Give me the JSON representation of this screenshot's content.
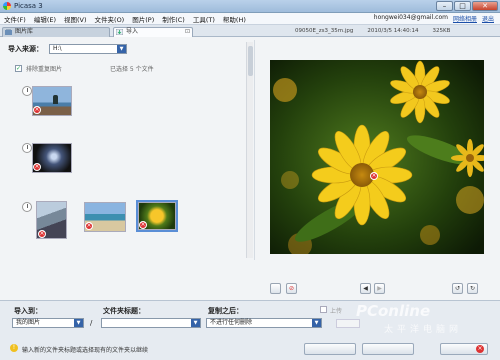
{
  "window": {
    "title": "Picasa 3",
    "buttons": [
      "–",
      "□",
      "✕"
    ]
  },
  "menu": {
    "items": [
      "文件(F)",
      "编辑(E)",
      "视图(V)",
      "文件夹(O)",
      "图片(P)",
      "制作(C)",
      "工具(T)",
      "帮助(H)"
    ],
    "account": "hongwei034@gmail.com",
    "links": [
      "网络相册",
      "退出"
    ]
  },
  "tabs": {
    "library": "图片库",
    "import": "导入",
    "import_close": "⊡"
  },
  "import_from": {
    "label": "导入来源：",
    "value": "H:\\"
  },
  "options": {
    "exclude_duplicates": "排除重复图片",
    "selected_count": "已选择 5 个文件"
  },
  "preview_meta": {
    "filename": "09050E_zs3_35m.jpg",
    "date": "2010/3/5 14:40:14",
    "size": "325KB"
  },
  "toolbar": {
    "prev": "◀",
    "next": "▶",
    "rotate_left": "↺",
    "rotate_right": "↻"
  },
  "bottom": {
    "import_to_label": "导入到：",
    "import_to_value": "我的图片",
    "separator": "/",
    "folder_title_label": "文件夹标题：",
    "folder_title_value": "",
    "after_copy_label": "复制之后：",
    "after_copy_value": "不进行任何删除",
    "upload_label": "上传",
    "hint": "输入新的文件夹标题或选择现有的文件夹以继续"
  },
  "watermark": {
    "brand": "PConline",
    "sub": "太平洋电脑网"
  },
  "colors": {
    "titlebar": "#b9d1ea",
    "accent": "#3563a8",
    "badge": "#dd3333"
  }
}
